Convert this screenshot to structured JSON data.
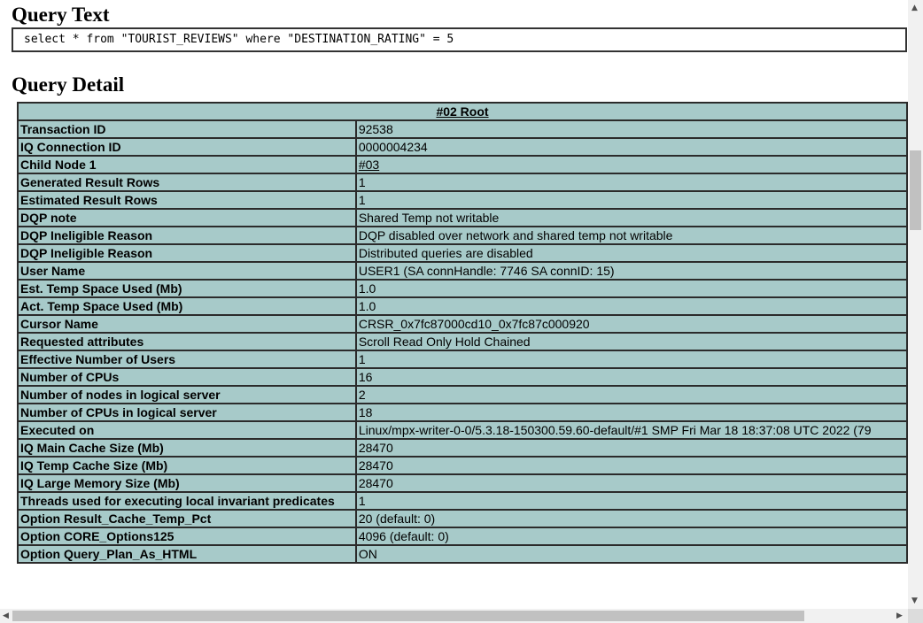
{
  "query_text": {
    "heading": "Query Text",
    "sql": "select * from \"TOURIST_REVIEWS\" where \"DESTINATION_RATING\" = 5"
  },
  "query_detail": {
    "heading": "Query Detail",
    "table_title": "#02 Root",
    "rows": [
      {
        "key": "Transaction ID",
        "value": "92538"
      },
      {
        "key": "IQ Connection ID",
        "value": "0000004234"
      },
      {
        "key": "Child Node 1",
        "value": "#03",
        "link": true
      },
      {
        "key": "Generated Result Rows",
        "value": "1"
      },
      {
        "key": "Estimated Result Rows",
        "value": "1"
      },
      {
        "key": "DQP note",
        "value": "Shared Temp not writable"
      },
      {
        "key": "DQP Ineligible Reason",
        "value": "DQP disabled over network and shared temp not writable"
      },
      {
        "key": "DQP Ineligible Reason",
        "value": "Distributed queries are disabled"
      },
      {
        "key": "User Name",
        "value": "USER1 (SA connHandle: 7746 SA connID: 15)"
      },
      {
        "key": "Est. Temp Space Used (Mb)",
        "value": "1.0"
      },
      {
        "key": "Act. Temp Space Used (Mb)",
        "value": "1.0"
      },
      {
        "key": "Cursor Name",
        "value": "CRSR_0x7fc87000cd10_0x7fc87c000920"
      },
      {
        "key": "Requested attributes",
        "value": "Scroll Read Only Hold Chained"
      },
      {
        "key": "Effective Number of Users",
        "value": "1"
      },
      {
        "key": "Number of CPUs",
        "value": "16"
      },
      {
        "key": "Number of nodes in logical server",
        "value": "2"
      },
      {
        "key": "Number of CPUs in logical server",
        "value": "18"
      },
      {
        "key": "Executed on",
        "value": "Linux/mpx-writer-0-0/5.3.18-150300.59.60-default/#1 SMP Fri Mar 18 18:37:08 UTC 2022 (79"
      },
      {
        "key": "IQ Main Cache Size (Mb)",
        "value": "28470"
      },
      {
        "key": "IQ Temp Cache Size (Mb)",
        "value": "28470"
      },
      {
        "key": "IQ Large Memory Size (Mb)",
        "value": "28470"
      },
      {
        "key": "Threads used for executing local invariant predicates",
        "value": "1"
      },
      {
        "key": "Option Result_Cache_Temp_Pct",
        "value": "20 (default: 0)"
      },
      {
        "key": "Option CORE_Options125",
        "value": "4096 (default: 0)"
      },
      {
        "key": "Option Query_Plan_As_HTML",
        "value": "ON"
      }
    ]
  },
  "scrollbars": {
    "vertical_icons": [
      "arrow-up-icon",
      "arrow-down-icon"
    ],
    "horizontal_icons": [
      "arrow-left-icon",
      "arrow-right-icon"
    ]
  },
  "colors": {
    "table_bg": "#a7cac9",
    "border": "#2b2b2b"
  }
}
